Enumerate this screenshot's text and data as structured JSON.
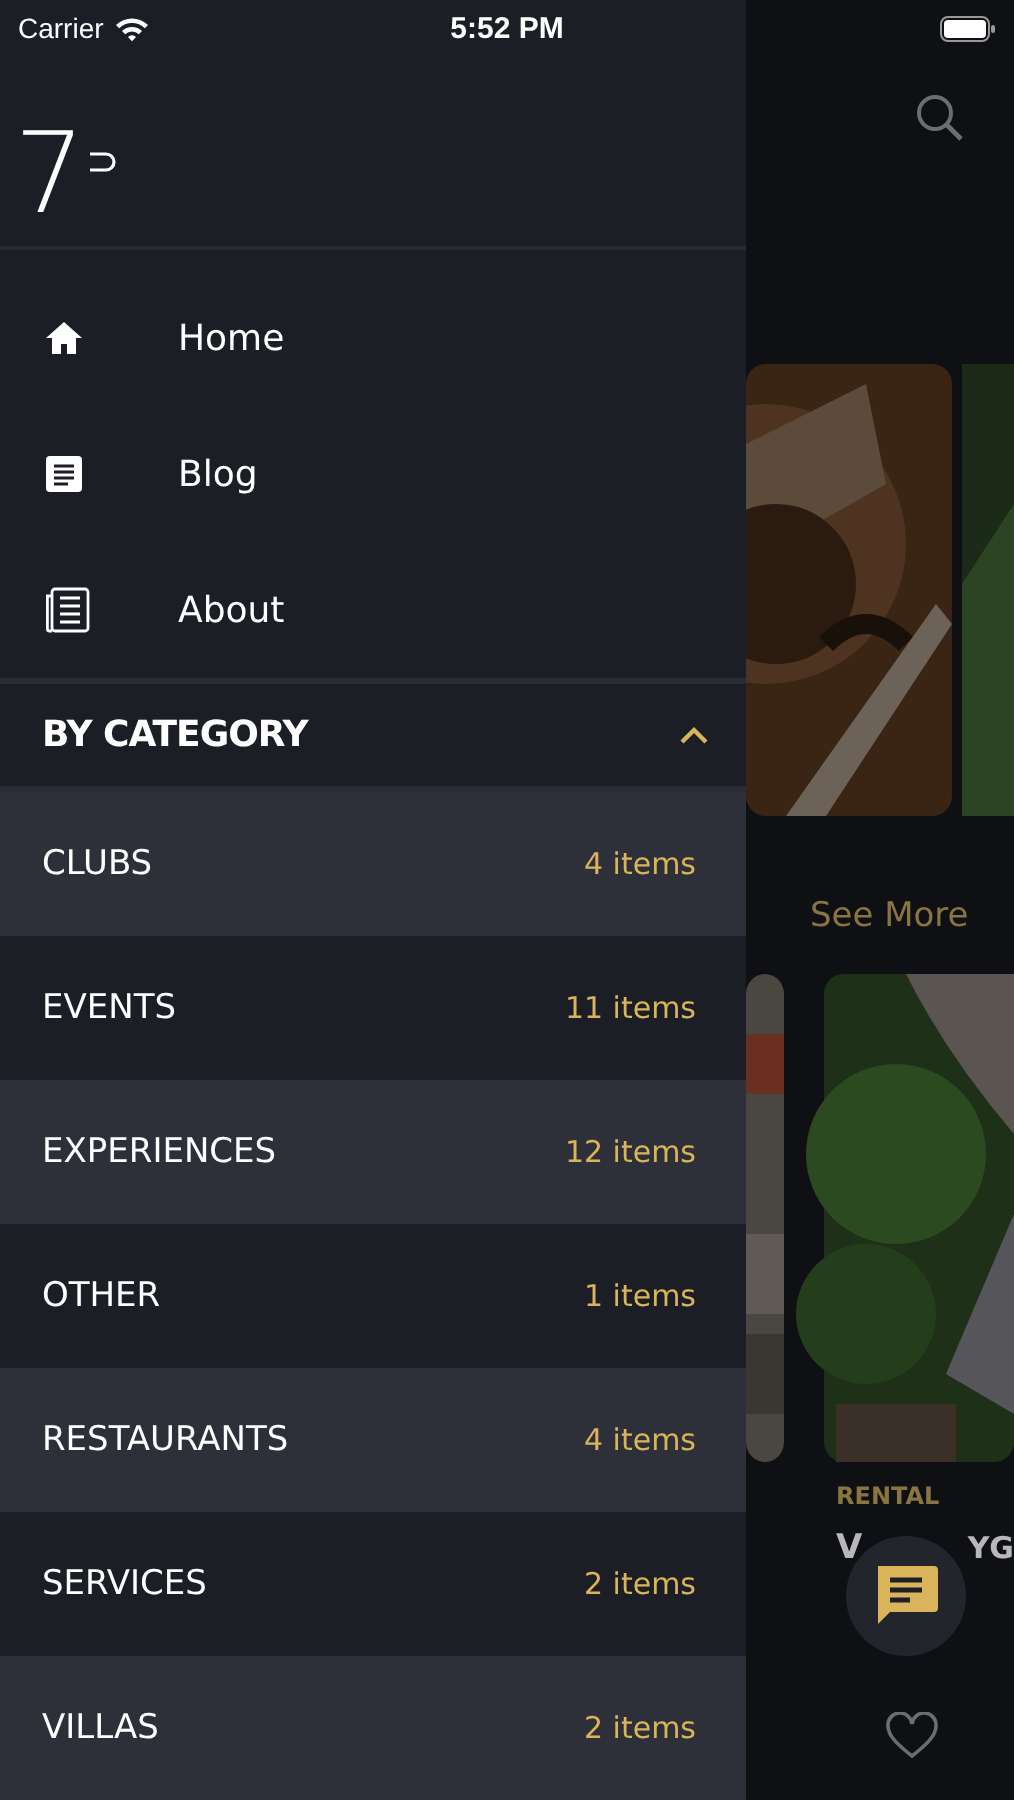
{
  "status_bar": {
    "carrier": "Carrier",
    "time": "5:52 PM"
  },
  "drawer": {
    "logo": "7",
    "nav_items": [
      {
        "label": "Home",
        "kind": "home"
      },
      {
        "label": "Blog",
        "kind": "blog"
      },
      {
        "label": "About",
        "kind": "about"
      }
    ],
    "category_header": {
      "label": "BY CATEGORY",
      "expanded": true
    },
    "categories": [
      {
        "name": "CLUBS",
        "count": "4 items"
      },
      {
        "name": "EVENTS",
        "count": "11 items"
      },
      {
        "name": "EXPERIENCES",
        "count": "12 items"
      },
      {
        "name": "OTHER",
        "count": "1 items"
      },
      {
        "name": "RESTAURANTS",
        "count": "4 items"
      },
      {
        "name": "SERVICES",
        "count": "2 items"
      },
      {
        "name": "VILLAS",
        "count": "2 items"
      }
    ]
  },
  "background": {
    "see_more": "See More",
    "card_tag": "RENTAL",
    "card_title_parts": [
      "V",
      "YG"
    ]
  }
}
